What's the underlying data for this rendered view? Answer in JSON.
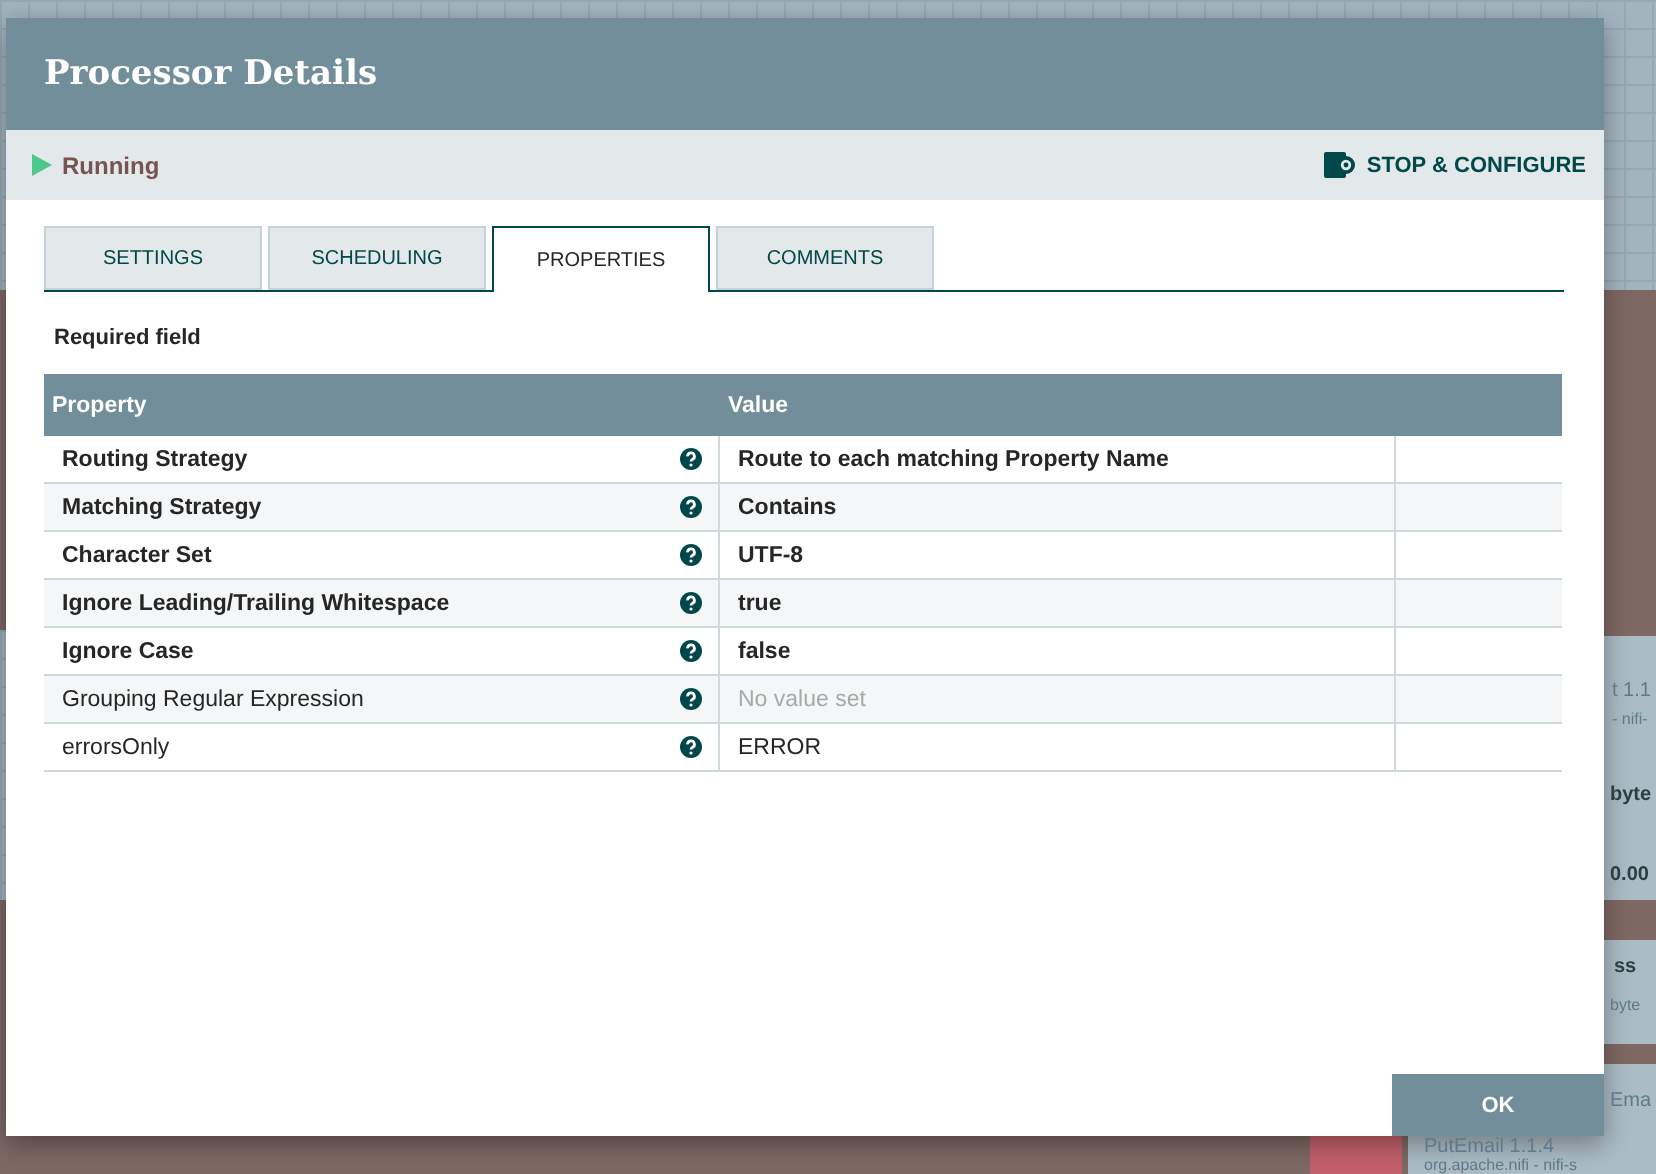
{
  "canvas": {
    "texts": [
      {
        "kind": "version",
        "text": "t 1.1"
      },
      {
        "kind": "sub",
        "text": "- nifi-"
      },
      {
        "kind": "stat",
        "text": "byte"
      },
      {
        "kind": "stat",
        "text": "0.00"
      },
      {
        "kind": "stat",
        "text": "ss"
      },
      {
        "kind": "sub",
        "text": "byte"
      },
      {
        "kind": "version",
        "text": "Ema"
      },
      {
        "kind": "version",
        "text": "PutEmail 1.1.4"
      },
      {
        "kind": "sub",
        "text": "org.apache.nifi - nifi-s"
      }
    ]
  },
  "dialog": {
    "title": "Processor Details",
    "status": {
      "label": "Running"
    },
    "action": "STOP & CONFIGURE",
    "tabs": [
      {
        "label": "SETTINGS",
        "selected": false
      },
      {
        "label": "SCHEDULING",
        "selected": false
      },
      {
        "label": "PROPERTIES",
        "selected": true
      },
      {
        "label": "COMMENTS",
        "selected": false
      }
    ],
    "required_note": "Required field",
    "table": {
      "columns": [
        "Property",
        "Value"
      ],
      "rows": [
        {
          "property": "Routing Strategy",
          "value": "Route to each matching Property Name",
          "required": true,
          "value_set": true
        },
        {
          "property": "Matching Strategy",
          "value": "Contains",
          "required": true,
          "value_set": true
        },
        {
          "property": "Character Set",
          "value": "UTF-8",
          "required": true,
          "value_set": true
        },
        {
          "property": "Ignore Leading/Trailing Whitespace",
          "value": "true",
          "required": true,
          "value_set": true
        },
        {
          "property": "Ignore Case",
          "value": "false",
          "required": true,
          "value_set": true
        },
        {
          "property": "Grouping Regular Expression",
          "value": "No value set",
          "required": false,
          "value_set": false
        },
        {
          "property": "errorsOnly",
          "value": "ERROR",
          "required": false,
          "value_set": true
        }
      ]
    },
    "buttons": [
      "OK"
    ]
  }
}
